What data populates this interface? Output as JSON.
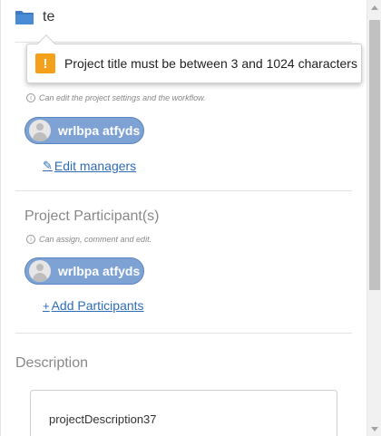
{
  "header": {
    "title_value": "te",
    "folder_icon": "folder-icon"
  },
  "tooltip": {
    "icon": "warning-icon",
    "icon_glyph": "!",
    "message": "Project title must be between 3 and 1024 characters",
    "accent_color": "#f5a01a"
  },
  "managers": {
    "hint": "Can edit the project settings and the workflow.",
    "user_name": "wrlbpa atfyds",
    "edit_link": "Edit managers"
  },
  "participants": {
    "title": "Project Participant(s)",
    "hint": "Can assign, comment and edit.",
    "user_name": "wrlbpa atfyds",
    "add_link": "Add Participants"
  },
  "description": {
    "title": "Description",
    "value": "projectDescription37"
  },
  "colors": {
    "chip_background": "#7da2d3",
    "link": "#2e6db4"
  }
}
